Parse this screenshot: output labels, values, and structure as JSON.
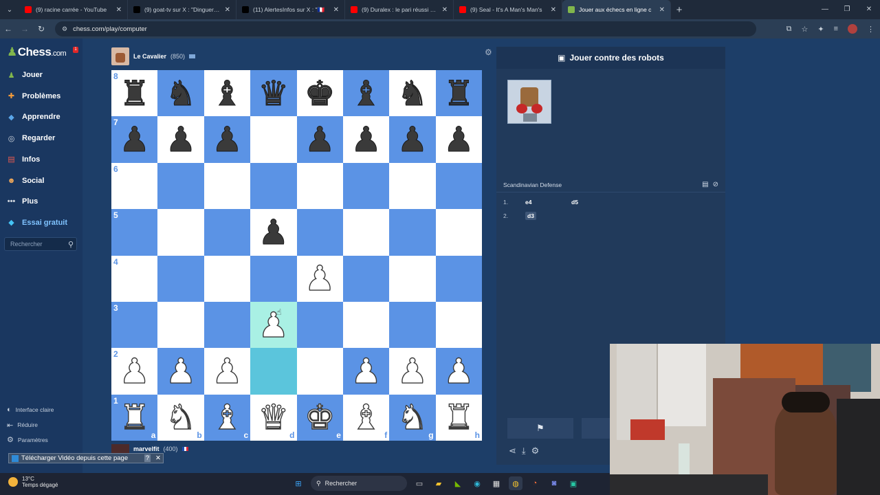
{
  "browser": {
    "tabs": [
      {
        "title": "(9) racine carrée - YouTube",
        "fav_color": "#ff0000",
        "active": false
      },
      {
        "title": "(9) goat-tv sur X : \"Dinguerie !",
        "fav_color": "#000000",
        "active": false
      },
      {
        "title": "(11) AlertesInfos sur X : \"🇫🇷",
        "fav_color": "#000000",
        "active": false
      },
      {
        "title": "(9) Duralex : le pari réussi des s",
        "fav_color": "#ff0000",
        "active": false
      },
      {
        "title": "(9) Seal - It's A Man's Man's",
        "fav_color": "#ff0000",
        "active": false
      },
      {
        "title": "Jouer aux échecs en ligne c",
        "fav_color": "#81b64c",
        "active": true
      }
    ],
    "url": "chess.com/play/computer"
  },
  "sidebar": {
    "logo_main": "Chess",
    "logo_suffix": ".com",
    "notification_count": "1",
    "items": [
      {
        "label": "Jouer",
        "icon": "play-icon",
        "color": "#81b64c"
      },
      {
        "label": "Problèmes",
        "icon": "puzzle-icon",
        "color": "#f29a3a"
      },
      {
        "label": "Apprendre",
        "icon": "learn-icon",
        "color": "#5aa6e8"
      },
      {
        "label": "Regarder",
        "icon": "binoculars-icon",
        "color": "#d0d6de"
      },
      {
        "label": "Infos",
        "icon": "news-icon",
        "color": "#e85a4f"
      },
      {
        "label": "Social",
        "icon": "social-icon",
        "color": "#f0a85a"
      },
      {
        "label": "Plus",
        "icon": "more-icon",
        "color": "#d0d6de"
      },
      {
        "label": "Essai gratuit",
        "icon": "diamond-icon",
        "color": "#45c4f5"
      }
    ],
    "search_placeholder": "Rechercher",
    "bottom": [
      {
        "label": "Interface claire",
        "icon": "light-mode-icon"
      },
      {
        "label": "Réduire",
        "icon": "collapse-icon"
      },
      {
        "label": "Paramètres",
        "icon": "settings-icon"
      }
    ]
  },
  "extension_toast": "Télécharger Vidéo depuis cette page",
  "top_player": {
    "name": "Le Cavalier",
    "rating": "(850)"
  },
  "bottom_player": {
    "name": "marvelfit",
    "rating": "(400)"
  },
  "board": {
    "ranks": [
      "8",
      "7",
      "6",
      "5",
      "4",
      "3",
      "2",
      "1"
    ],
    "files": [
      "a",
      "b",
      "c",
      "d",
      "e",
      "f",
      "g",
      "h"
    ],
    "position": [
      [
        "bR",
        "bN",
        "bB",
        "bQ",
        "bK",
        "bB",
        "bN",
        "bR"
      ],
      [
        "bP",
        "bP",
        "bP",
        "",
        "bP",
        "bP",
        "bP",
        "bP"
      ],
      [
        "",
        "",
        "",
        "",
        "",
        "",
        "",
        ""
      ],
      [
        "",
        "",
        "",
        "bP",
        "",
        "",
        "",
        ""
      ],
      [
        "",
        "",
        "",
        "",
        "wP",
        "",
        "",
        ""
      ],
      [
        "",
        "",
        "",
        "wP",
        "",
        "",
        "",
        ""
      ],
      [
        "wP",
        "wP",
        "wP",
        "",
        "",
        "wP",
        "wP",
        "wP"
      ],
      [
        "wR",
        "wN",
        "wB",
        "wQ",
        "wK",
        "wB",
        "wN",
        "wR"
      ]
    ],
    "highlighted": [
      "d3",
      "d2"
    ],
    "light_color": "#ffffff",
    "dark_color": "#5b93e5"
  },
  "panel": {
    "title": "Jouer contre des robots",
    "opening": "Scandinavian Defense",
    "moves": [
      {
        "num": "1.",
        "white": "e4",
        "black": "d5"
      },
      {
        "num": "2.",
        "white": "d3",
        "black": ""
      }
    ]
  },
  "taskbar": {
    "temperature": "13°C",
    "weather": "Temps dégagé",
    "search": "Rechercher"
  }
}
